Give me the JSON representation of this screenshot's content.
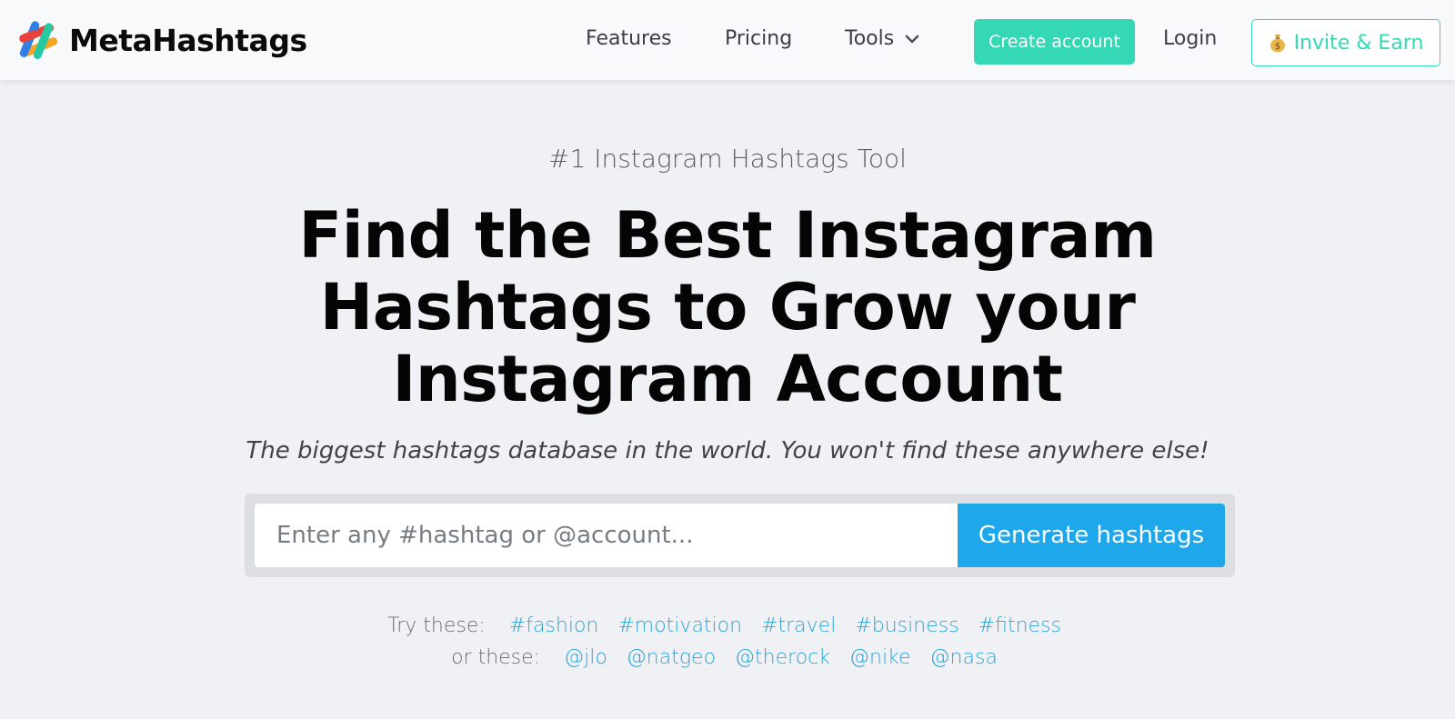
{
  "brand": {
    "name": "MetaHashtags"
  },
  "nav": {
    "features": "Features",
    "pricing": "Pricing",
    "tools": "Tools",
    "create_account": "Create account",
    "login": "Login",
    "invite": "Invite & Earn"
  },
  "hero": {
    "kicker": "#1 Instagram Hashtags Tool",
    "headline_line1": "Find the Best Instagram",
    "headline_line2": "Hashtags to Grow your",
    "headline_line3": "Instagram Account",
    "subline": "The biggest hashtags database in the world. You won't find these anywhere else!"
  },
  "search": {
    "placeholder": "Enter any #hashtag or @account...",
    "button": "Generate hashtags"
  },
  "suggestions": {
    "hashtags_label": "Try these:",
    "hashtags": [
      "#fashion",
      "#motivation",
      "#travel",
      "#business",
      "#fitness"
    ],
    "accounts_label": "or these:",
    "accounts": [
      "@jlo",
      "@natgeo",
      "@therock",
      "@nike",
      "@nasa"
    ]
  },
  "colors": {
    "accent_green": "#34d8b4",
    "accent_blue": "#1ea7ea",
    "link_blue": "#2ea6d8"
  },
  "icons": {
    "logo": "metahashtags-logo-icon",
    "tools_dropdown": "chevron-down-icon",
    "invite": "moneybag-icon"
  }
}
